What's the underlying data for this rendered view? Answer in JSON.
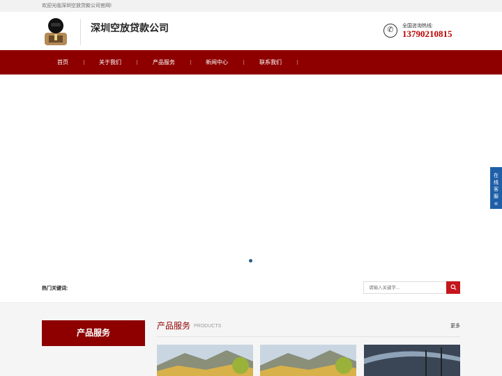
{
  "topbar": {
    "welcome": "欢迎光临深圳空放贷款公司官网!"
  },
  "header": {
    "site_name": "深圳空放贷款公司",
    "hotline_label": "全国咨询热线:",
    "hotline_number": "13790210815",
    "phone_icon": "phone-icon"
  },
  "nav": {
    "items": [
      {
        "label": "首页"
      },
      {
        "label": "关于我们"
      },
      {
        "label": "产品服务"
      },
      {
        "label": "新闻中心"
      },
      {
        "label": "联系我们"
      }
    ]
  },
  "search": {
    "keywords_label": "热门关键词:",
    "placeholder": "请输入关键字...",
    "icon": "search-icon"
  },
  "sidebar": {
    "title": "产品服务"
  },
  "section": {
    "title": "产品服务",
    "subtitle": "PRODUCTS",
    "more": "更多"
  },
  "float_service": {
    "label_chars": [
      "在",
      "线",
      "客",
      "服"
    ],
    "arrow": "«"
  },
  "colors": {
    "primary": "#8e0000",
    "accent": "#c4161c",
    "service": "#1f5fa8"
  }
}
